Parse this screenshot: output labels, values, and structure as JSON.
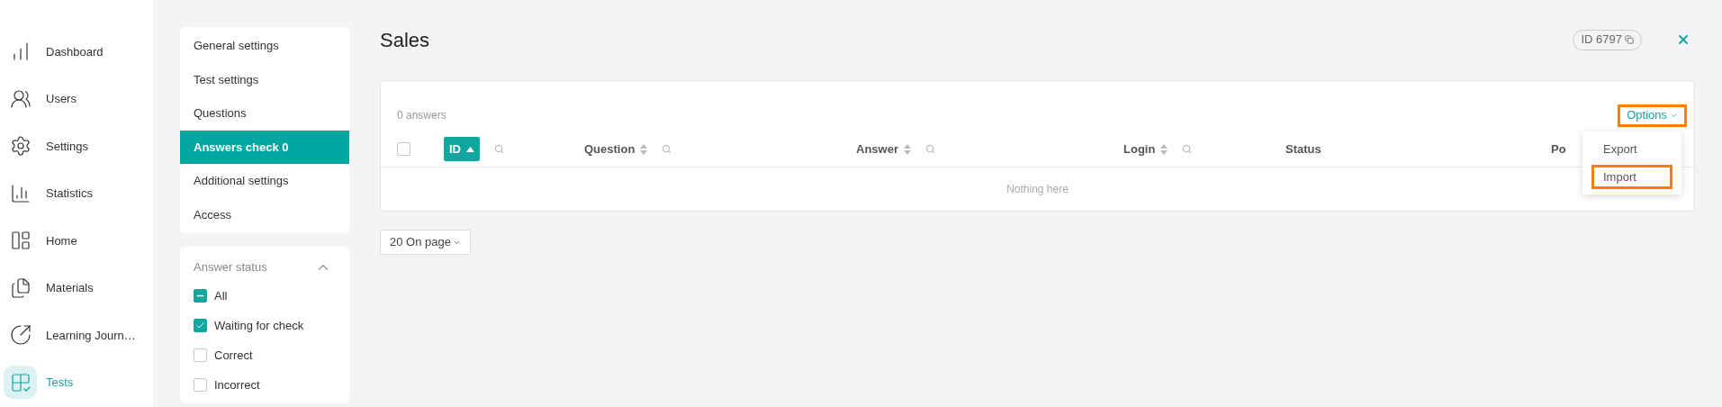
{
  "sidebar": {
    "items": [
      {
        "label": "Dashboard",
        "selected": false
      },
      {
        "label": "Users",
        "selected": false
      },
      {
        "label": "Settings",
        "selected": false
      },
      {
        "label": "Statistics",
        "selected": false
      },
      {
        "label": "Home",
        "selected": false
      },
      {
        "label": "Materials",
        "selected": false
      },
      {
        "label": "Learning Journ…",
        "selected": false
      },
      {
        "label": "Tests",
        "selected": true
      }
    ]
  },
  "settings_menu": {
    "items": [
      {
        "label": "General settings",
        "selected": false
      },
      {
        "label": "Test settings",
        "selected": false
      },
      {
        "label": "Questions",
        "selected": false
      },
      {
        "label": "Answers check 0",
        "selected": true
      },
      {
        "label": "Additional settings",
        "selected": false
      },
      {
        "label": "Access",
        "selected": false
      }
    ]
  },
  "answer_status_filter": {
    "title": "Answer status",
    "expanded": true,
    "options": [
      {
        "label": "All",
        "checked": true,
        "indeterminate": true
      },
      {
        "label": "Waiting for check",
        "checked": true,
        "indeterminate": false
      },
      {
        "label": "Correct",
        "checked": false,
        "indeterminate": false
      },
      {
        "label": "Incorrect",
        "checked": false,
        "indeterminate": false
      }
    ]
  },
  "header": {
    "title": "Sales",
    "id_badge": "ID 6797"
  },
  "table": {
    "count": "0 answers",
    "select_all": {
      "checked": false
    },
    "options": {
      "label": "Options",
      "highlighted": true
    },
    "menu": [
      {
        "label": "Export",
        "highlighted": false
      },
      {
        "label": "Import",
        "highlighted": true
      }
    ],
    "columns": [
      {
        "label": "ID",
        "selected": true,
        "sortable": true,
        "searchable": true
      },
      {
        "label": "Question",
        "selected": false,
        "sortable": true,
        "searchable": true
      },
      {
        "label": "Answer",
        "selected": false,
        "sortable": true,
        "searchable": true
      },
      {
        "label": "Login",
        "selected": false,
        "sortable": true,
        "searchable": true
      },
      {
        "label": "Status",
        "selected": false,
        "sortable": false,
        "searchable": false
      },
      {
        "label": "Po",
        "selected": false,
        "sortable": false,
        "searchable": false
      }
    ],
    "empty_text": "Nothing here"
  },
  "pagination": {
    "page_size": "20 On page"
  }
}
